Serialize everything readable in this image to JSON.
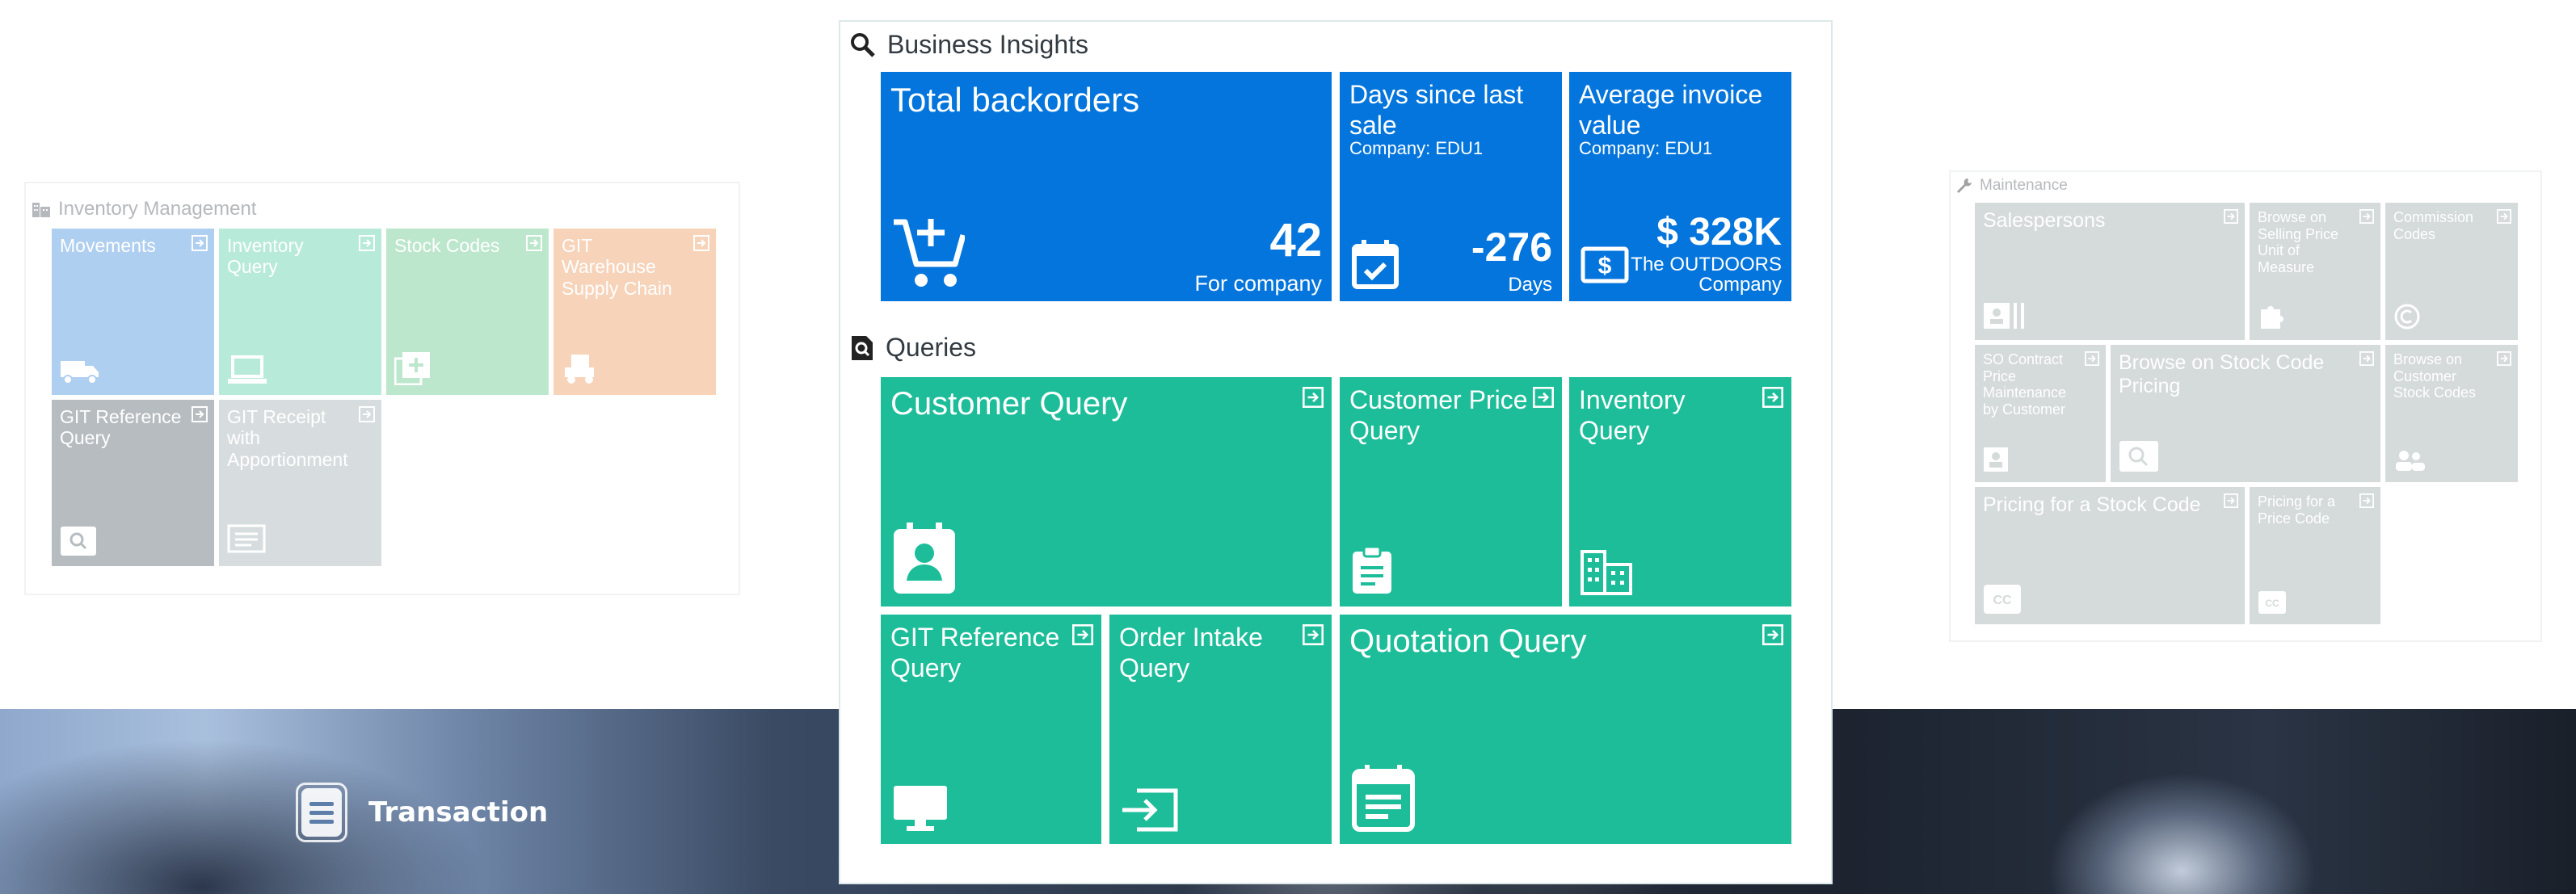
{
  "transaction": {
    "label": "Transaction"
  },
  "inventory_panel": {
    "title": "Inventory Management",
    "tiles": [
      {
        "label": "Movements",
        "color": "#6fa9e6",
        "icon": "truck-icon"
      },
      {
        "label": "Inventory Query",
        "color": "#7fd9bd",
        "icon": "laptop-icon"
      },
      {
        "label": "Stock Codes",
        "color": "#88d4a4",
        "icon": "add-copy-icon"
      },
      {
        "label": "GIT Warehouse Supply Chain",
        "color": "#f0b080",
        "icon": "forklift-icon"
      },
      {
        "label": "GIT Reference Query",
        "color": "#7d8790",
        "icon": "search-icon"
      },
      {
        "label": "GIT Receipt with Apportionment",
        "color": "#b8c2c4",
        "icon": "document-icon"
      }
    ]
  },
  "maintenance_panel": {
    "title": "Maintenance",
    "tiles": [
      {
        "label": "Salespersons",
        "icon": "id-card-icon"
      },
      {
        "label": "Browse on Selling Price Unit of Measure",
        "icon": "puzzle-icon"
      },
      {
        "label": "Commission Codes",
        "icon": "copyright-icon"
      },
      {
        "label": "SO Contract Price Maintenance by Customer",
        "icon": "contact-icon"
      },
      {
        "label": "Browse on Stock Code Pricing",
        "icon": "search-icon"
      },
      {
        "label": "Browse on Customer Stock Codes",
        "icon": "users-icon"
      },
      {
        "label": "Pricing for a Stock Code",
        "icon": "cc-icon"
      },
      {
        "label": "Pricing for a Price Code",
        "icon": "cc-icon"
      }
    ]
  },
  "business_insights": {
    "title": "Business Insights",
    "tiles": [
      {
        "label": "Total backorders",
        "value": "42",
        "caption": "For company"
      },
      {
        "label": "Days since last sale",
        "sub": "Company: EDU1",
        "value": "-276",
        "caption": "Days"
      },
      {
        "label": "Average invoice value",
        "sub": "Company: EDU1",
        "value": "$ 328K",
        "caption": "The OUTDOORS Company"
      }
    ]
  },
  "queries": {
    "title": "Queries",
    "tiles": [
      {
        "label": "Customer Query",
        "icon": "contact-card-icon"
      },
      {
        "label": "Customer Price Query",
        "icon": "clipboard-icon"
      },
      {
        "label": "Inventory Query",
        "icon": "building-icon"
      },
      {
        "label": "GIT Reference Query",
        "icon": "monitor-icon"
      },
      {
        "label": "Order Intake Query",
        "icon": "sign-in-icon"
      },
      {
        "label": "Quotation Query",
        "icon": "calendar-note-icon"
      }
    ]
  },
  "colors": {
    "blue_tile": "#0475dc",
    "green_tile": "#1dbd9a",
    "maintenance_tile": "#b3bcbd"
  }
}
